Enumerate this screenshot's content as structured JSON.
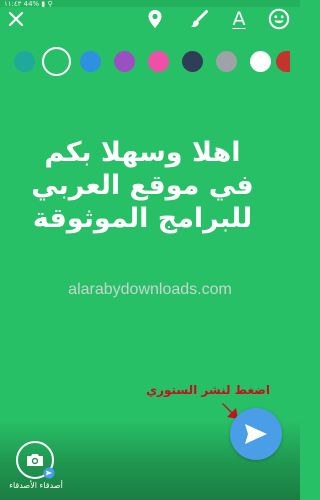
{
  "status_bar": {
    "text": "١١:٤٣ 44% ▮ ⚲"
  },
  "toolbar": {
    "close_icon": "close-icon",
    "location_icon": "location-pin-icon",
    "brush_icon": "brush-icon",
    "text_tool_label": "A",
    "emoji_icon": "emoji-icon"
  },
  "palette": {
    "colors": [
      "#1fa99a",
      "#28c066",
      "#2f8fe0",
      "#9b4fc2",
      "#ef4fa8",
      "#2d3e55",
      "#9ea3a8",
      "#ffffff",
      "#c3342c"
    ],
    "selected_index": 1
  },
  "story": {
    "line1": "اهلا وسهلا بكم",
    "line2": "في موقع العربي",
    "line3": "للبرامج الموثوقة"
  },
  "watermark": "alarabydownloads.com",
  "hint": "اضغط لنشر الستوري",
  "bottom": {
    "friends_label": "أصدقاء الأصدقاء",
    "send_icon": "send-icon"
  },
  "accent": {
    "send_button": "#4a9ee8",
    "hint_text": "#c1121f",
    "arrow": "#c1121f"
  }
}
